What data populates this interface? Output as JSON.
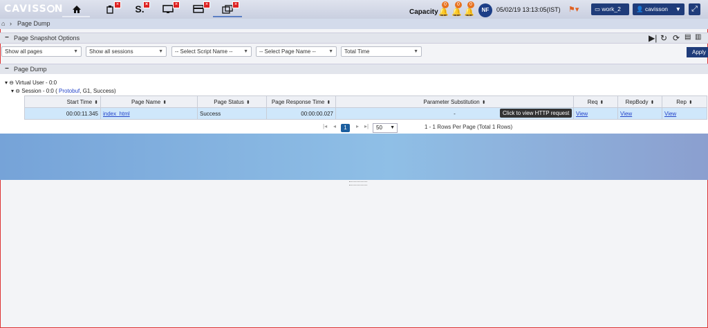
{
  "header": {
    "logo": "CAVISS",
    "logo_tail": "N",
    "icons": [
      "home-icon",
      "analysis-icon",
      "s-icon",
      "monitor-icon",
      "card-icon",
      "window-icon"
    ],
    "capacity_label": "Capacity",
    "alerts": [
      "0",
      "0",
      "0"
    ],
    "avatar": "NF",
    "datetime": "05/02/19 13:13:05(IST)",
    "workspace": "work_2",
    "user": "cavisson",
    "accent": "#1f3c7a"
  },
  "breadcrumb": {
    "title": "Page Dump"
  },
  "options": {
    "title": "Page Snapshot Options",
    "selects": [
      "Show all pages",
      "Show all sessions",
      "-- Select Script Name --",
      "-- Select Page Name --",
      "Total Time"
    ],
    "apply": "Apply"
  },
  "dump": {
    "title": "Page Dump",
    "virtual_user": "Virtual User - 0:0",
    "session_prefix": "Session - 0:0 ( ",
    "session_link": "Protobuf",
    "session_suffix": ", G1, Success)",
    "columns": [
      "Start Time",
      "Page Name",
      "Page Status",
      "Page Response Time",
      "Parameter Substitution",
      "Req",
      "RepBody",
      "Rep"
    ],
    "rows": [
      {
        "start": "00:00:11.345",
        "page": "index_html",
        "status": "Success",
        "resp": "00:00:00.027",
        "param": "-",
        "req": "View",
        "repbody": "View",
        "rep": "View"
      }
    ],
    "tooltip": "Click to view HTTP request",
    "pager": {
      "page": "1",
      "per_page": "50",
      "info": "1 - 1 Rows Per Page (Total 1 Rows)"
    }
  }
}
